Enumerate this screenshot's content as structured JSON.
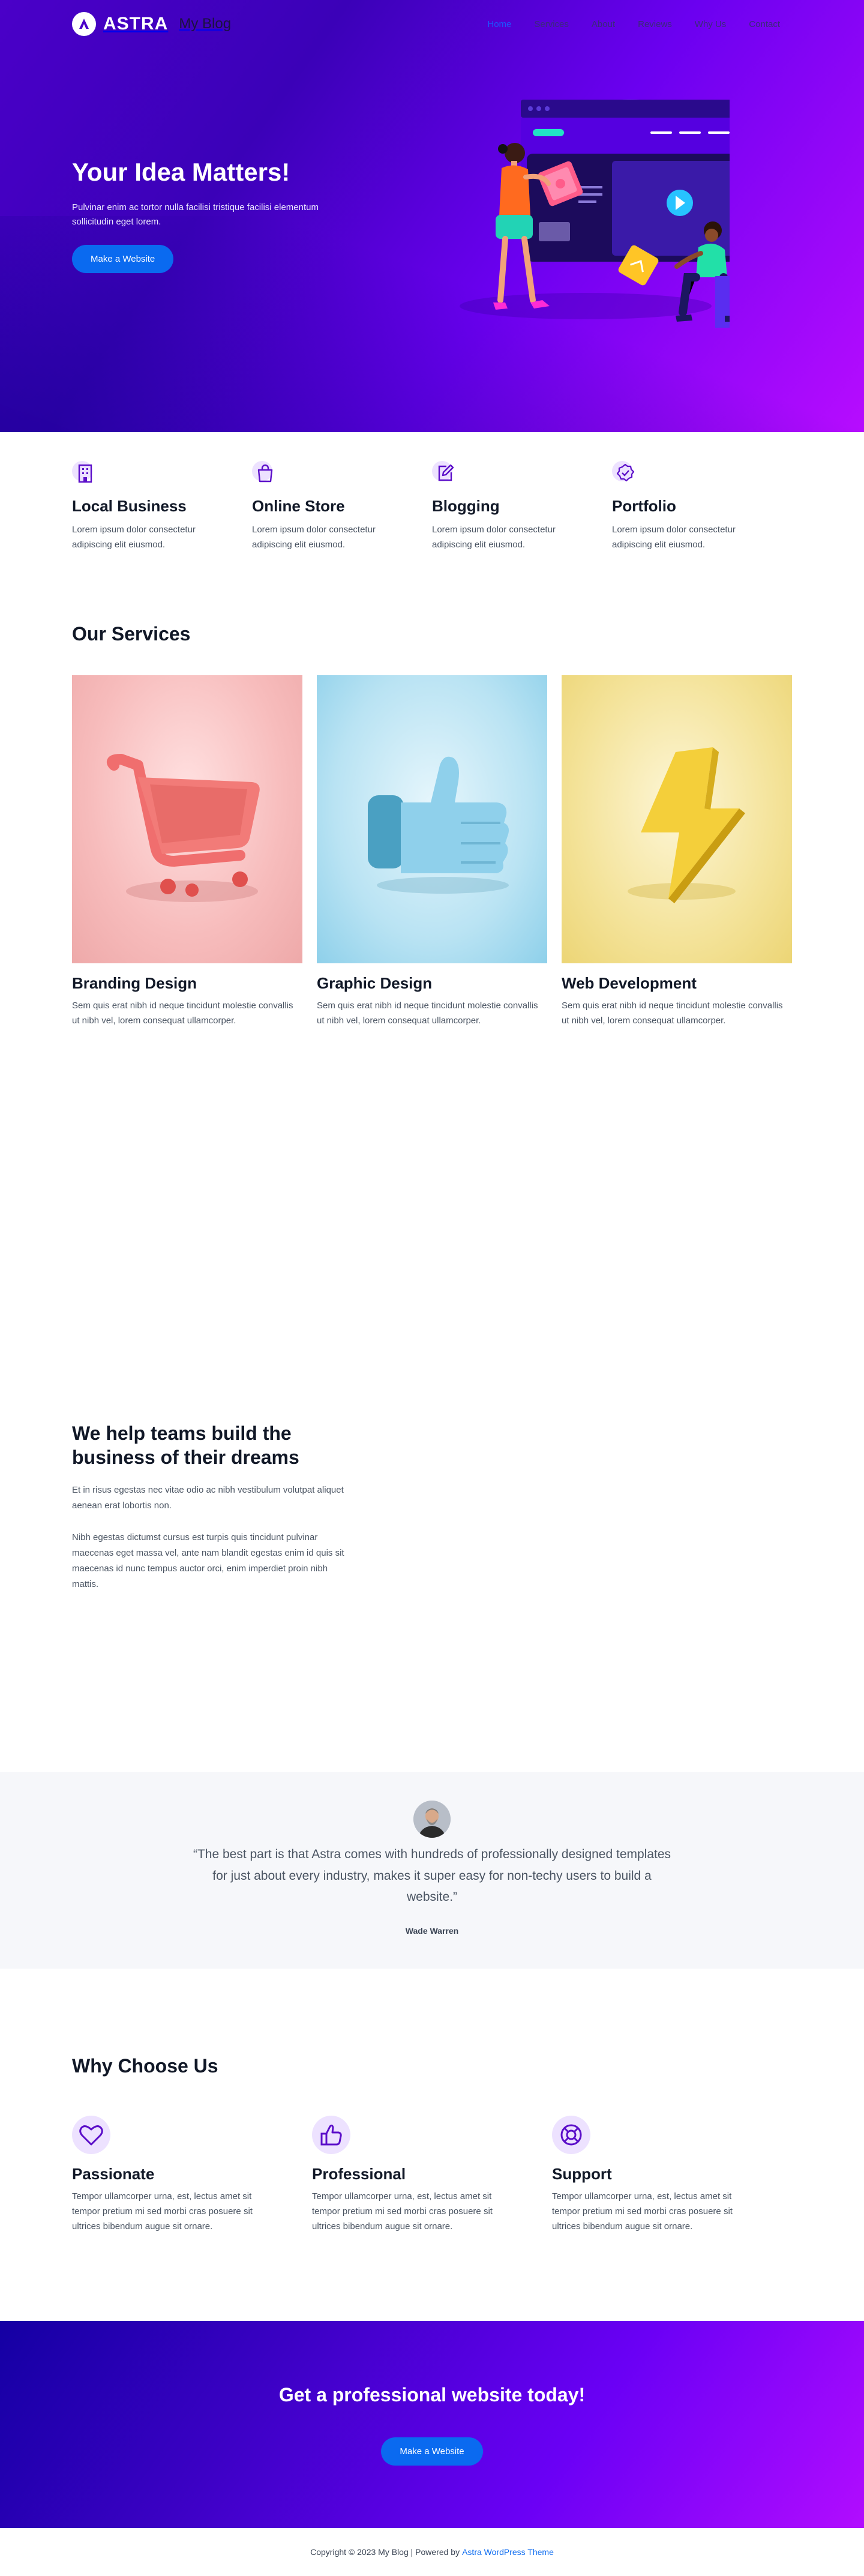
{
  "header": {
    "logo_text": "ASTRA",
    "site_title": "My Blog",
    "menu": [
      "Home",
      "Services",
      "About",
      "Reviews",
      "Why Us",
      "Contact"
    ]
  },
  "hero": {
    "title": "Your Idea Matters!",
    "subtitle": "Pulvinar enim ac tortor nulla facilisi tristique facilisi elementum sollicitudin eget lorem.",
    "button": "Make a Website"
  },
  "features": [
    {
      "icon": "building-icon",
      "title": "Local Business",
      "text": "Lorem ipsum dolor consectetur adipiscing elit eiusmod."
    },
    {
      "icon": "shopping-bag-icon",
      "title": "Online Store",
      "text": "Lorem ipsum dolor consectetur adipiscing elit eiusmod."
    },
    {
      "icon": "edit-icon",
      "title": "Blogging",
      "text": "Lorem ipsum dolor consectetur adipiscing elit eiusmod."
    },
    {
      "icon": "badge-check-icon",
      "title": "Portfolio",
      "text": "Lorem ipsum dolor consectetur adipiscing elit eiusmod."
    }
  ],
  "services": {
    "title": "Our Services",
    "items": [
      {
        "image": "shopping-cart-image",
        "title": "Branding Design",
        "text": "Sem quis erat nibh id neque tincidunt molestie convallis ut nibh vel, lorem consequat ullamcorper."
      },
      {
        "image": "thumbs-up-image",
        "title": "Graphic Design",
        "text": "Sem quis erat nibh id neque tincidunt molestie convallis ut nibh vel, lorem consequat ullamcorper."
      },
      {
        "image": "lightning-bolt-image",
        "title": "Web Development",
        "text": "Sem quis erat nibh id neque tincidunt molestie convallis ut nibh vel, lorem consequat ullamcorper."
      }
    ]
  },
  "teams": {
    "title": "We help teams build the business of their dreams",
    "para1": "Et in risus egestas nec vitae odio ac nibh vestibulum volutpat aliquet aenean erat lobortis non.",
    "para2": "Nibh egestas dictumst cursus est turpis quis tincidunt pulvinar maecenas eget massa vel, ante nam blandit egestas enim id quis sit maecenas id nunc tempus auctor orci, enim imperdiet proin nibh mattis."
  },
  "testimonial": {
    "quote": "“The best part is that Astra comes with hundreds of professionally designed templates for just about every industry, makes it super easy for non-techy users to build a website.”",
    "author": "Wade Warren"
  },
  "why": {
    "title": "Why Choose Us",
    "items": [
      {
        "icon": "heart-icon",
        "title": "Passionate",
        "text": "Tempor ullamcorper urna, est, lectus amet sit tempor pretium mi sed morbi cras posuere sit ultrices bibendum augue sit ornare."
      },
      {
        "icon": "thumbs-up-icon",
        "title": "Professional",
        "text": "Tempor ullamcorper urna, est, lectus amet sit tempor pretium mi sed morbi cras posuere sit ultrices bibendum augue sit ornare."
      },
      {
        "icon": "lifebuoy-icon",
        "title": "Support",
        "text": "Tempor ullamcorper urna, est, lectus amet sit tempor pretium mi sed morbi cras posuere sit ultrices bibendum augue sit ornare."
      }
    ]
  },
  "cta": {
    "title": "Get a professional website today!",
    "button": "Make a Website"
  },
  "footer": {
    "copyright": "Copyright © 2023 My Blog | Powered by",
    "link": "Astra WordPress Theme"
  },
  "colors": {
    "accent": "#0a6af0",
    "purple": "#6a00f5",
    "icon_stroke": "#5b0ec9",
    "icon_bg": "#ede2ff"
  }
}
